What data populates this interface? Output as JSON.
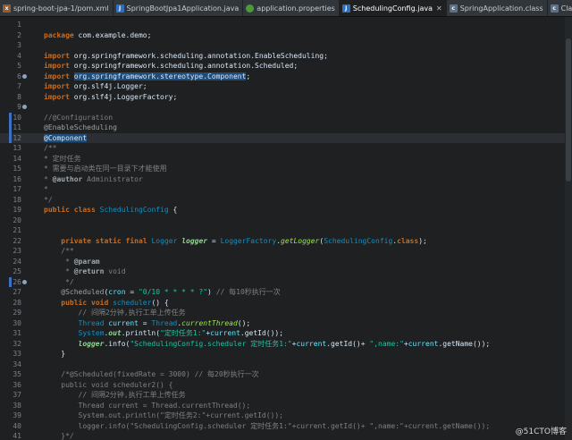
{
  "tabs": [
    {
      "label": "spring-boot-jpa-1/pom.xml",
      "icon": "xml-file-icon",
      "glyph": "x",
      "kind": "xml",
      "active": false,
      "closable": false
    },
    {
      "label": "SpringBootJpa1Application.java",
      "icon": "java-file-icon",
      "glyph": "J",
      "kind": "java",
      "active": false,
      "closable": false
    },
    {
      "label": "application.properties",
      "icon": "properties-file-icon",
      "glyph": "",
      "kind": "props",
      "active": false,
      "closable": false
    },
    {
      "label": "SchedulingConfig.java",
      "icon": "java-file-icon",
      "glyph": "J",
      "kind": "java",
      "active": true,
      "closable": true
    },
    {
      "label": "SpringApplication.class",
      "icon": "class-file-icon",
      "glyph": "c",
      "kind": "cls",
      "active": false,
      "closable": false
    },
    {
      "label": "Class.cla",
      "icon": "class-file-icon",
      "glyph": "c",
      "kind": "cls",
      "active": false,
      "closable": false
    }
  ],
  "close_glyph": "✕",
  "editor": {
    "current_line": 12,
    "modified_lines": [
      10,
      11,
      12,
      26
    ],
    "gutter_markers": [
      6,
      9,
      26
    ],
    "lines": [
      [],
      [
        [
          "kw",
          "package"
        ],
        [
          "pl",
          " com.example.demo;"
        ]
      ],
      [],
      [
        [
          "kw",
          "import"
        ],
        [
          "pl",
          " org.springframework.scheduling.annotation.EnableScheduling;"
        ]
      ],
      [
        [
          "kw",
          "import"
        ],
        [
          "pl",
          " org.springframework.scheduling.annotation.Scheduled;"
        ]
      ],
      [
        [
          "kw",
          "import"
        ],
        [
          "pl",
          " "
        ],
        [
          "hl",
          "org.springframework.stereotype.Component"
        ],
        [
          "pl",
          ";"
        ]
      ],
      [
        [
          "kw",
          "import"
        ],
        [
          "pl",
          " org.slf4j.Logger;"
        ]
      ],
      [
        [
          "kw",
          "import"
        ],
        [
          "pl",
          " org.slf4j.LoggerFactory;"
        ]
      ],
      [],
      [
        [
          "cm",
          "//@Configuration"
        ]
      ],
      [
        [
          "an",
          "@EnableScheduling"
        ]
      ],
      [
        [
          "hl",
          "@Component"
        ]
      ],
      [
        [
          "cm",
          "/**"
        ]
      ],
      [
        [
          "cm",
          "* 定时任务"
        ]
      ],
      [
        [
          "cm",
          "* 需要与启动类在同一目录下才能使用"
        ]
      ],
      [
        [
          "cm",
          "* "
        ],
        [
          "dk",
          "@author"
        ],
        [
          "cm",
          " Administrator"
        ]
      ],
      [
        [
          "cm",
          "*"
        ]
      ],
      [
        [
          "cm",
          "*/"
        ]
      ],
      [
        [
          "kw",
          "public"
        ],
        [
          "pl",
          " "
        ],
        [
          "kw",
          "class"
        ],
        [
          "pl",
          " "
        ],
        [
          "ty",
          "SchedulingConfig"
        ],
        [
          "pl",
          " {"
        ]
      ],
      [],
      [],
      [
        [
          "pl",
          "    "
        ],
        [
          "kw",
          "private"
        ],
        [
          "pl",
          " "
        ],
        [
          "kw",
          "static"
        ],
        [
          "pl",
          " "
        ],
        [
          "kw",
          "final"
        ],
        [
          "pl",
          " "
        ],
        [
          "ty",
          "Logger"
        ],
        [
          "pl",
          " "
        ],
        [
          "fi",
          "logger"
        ],
        [
          "pl",
          " = "
        ],
        [
          "ty",
          "LoggerFactory"
        ],
        [
          "pl",
          "."
        ],
        [
          "mi",
          "getLogger"
        ],
        [
          "pl",
          "("
        ],
        [
          "ty",
          "SchedulingConfig"
        ],
        [
          "pl",
          "."
        ],
        [
          "kw",
          "class"
        ],
        [
          "pl",
          ");"
        ]
      ],
      [
        [
          "cm",
          "    /**"
        ]
      ],
      [
        [
          "cm",
          "     * "
        ],
        [
          "dk",
          "@param"
        ]
      ],
      [
        [
          "cm",
          "     * "
        ],
        [
          "dk",
          "@return"
        ],
        [
          "cm",
          " void"
        ]
      ],
      [
        [
          "cm",
          "     */"
        ]
      ],
      [
        [
          "pl",
          "    "
        ],
        [
          "an",
          "@Scheduled"
        ],
        [
          "pl",
          "("
        ],
        [
          "fl",
          "cron"
        ],
        [
          "pl",
          " = "
        ],
        [
          "st",
          "\"0/10 * * * * ?\""
        ],
        [
          "pl",
          ") "
        ],
        [
          "cm",
          "// 每10秒执行一次"
        ]
      ],
      [
        [
          "pl",
          "    "
        ],
        [
          "kw",
          "public"
        ],
        [
          "pl",
          " "
        ],
        [
          "kw",
          "void"
        ],
        [
          "pl",
          " "
        ],
        [
          "ty",
          "scheduler"
        ],
        [
          "pl",
          "() {"
        ]
      ],
      [
        [
          "cm",
          "        // 间隔2分钟,执行工单上传任务"
        ]
      ],
      [
        [
          "pl",
          "        "
        ],
        [
          "ty",
          "Thread"
        ],
        [
          "pl",
          " "
        ],
        [
          "fl",
          "current"
        ],
        [
          "pl",
          " = "
        ],
        [
          "ty",
          "Thread"
        ],
        [
          "pl",
          "."
        ],
        [
          "mi",
          "currentThread"
        ],
        [
          "pl",
          "();"
        ]
      ],
      [
        [
          "pl",
          "        "
        ],
        [
          "ty",
          "System"
        ],
        [
          "pl",
          "."
        ],
        [
          "fi",
          "out"
        ],
        [
          "pl",
          ".println("
        ],
        [
          "st",
          "\"定时任务1:\""
        ],
        [
          "pl",
          "+"
        ],
        [
          "fl",
          "current"
        ],
        [
          "pl",
          ".getId());"
        ]
      ],
      [
        [
          "pl",
          "        "
        ],
        [
          "fi",
          "logger"
        ],
        [
          "pl",
          ".info("
        ],
        [
          "st",
          "\"SchedulingConfig.scheduler 定时任务1:\""
        ],
        [
          "pl",
          "+"
        ],
        [
          "fl",
          "current"
        ],
        [
          "pl",
          ".getId()+ "
        ],
        [
          "st",
          "\",name:\""
        ],
        [
          "pl",
          "+"
        ],
        [
          "fl",
          "current"
        ],
        [
          "pl",
          ".getName());"
        ]
      ],
      [
        [
          "pl",
          "    }"
        ]
      ],
      [],
      [
        [
          "cm",
          "    /*@Scheduled(fixedRate = 3000) // 每20秒执行一次"
        ]
      ],
      [
        [
          "cm",
          "    public void scheduler2() {"
        ]
      ],
      [
        [
          "cm",
          "        // 间隔2分钟,执行工单上传任务"
        ]
      ],
      [
        [
          "cm",
          "        Thread current = Thread.currentThread();"
        ]
      ],
      [
        [
          "cm",
          "        System.out.println(\"定时任务2:\"+current.getId());"
        ]
      ],
      [
        [
          "cm",
          "        logger.info(\"SchedulingConfig.scheduler 定时任务1:\"+current.getId()+ \",name:\"+current.getName());"
        ]
      ],
      [
        [
          "cm",
          "    }*/"
        ]
      ],
      [
        [
          "pl",
          "}"
        ]
      ]
    ]
  },
  "watermark": "@51CTO博客"
}
